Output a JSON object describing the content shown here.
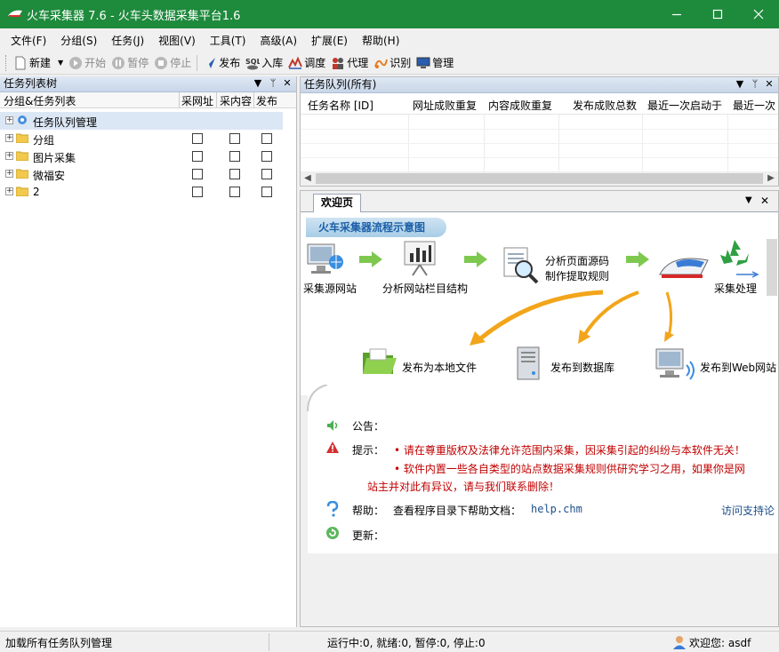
{
  "window": {
    "title": "火车采集器 7.6 - 火车头数据采集平台1.6"
  },
  "menu": [
    "文件(F)",
    "分组(S)",
    "任务(J)",
    "视图(V)",
    "工具(T)",
    "高级(A)",
    "扩展(E)",
    "帮助(H)"
  ],
  "toolbar": {
    "new": "新建",
    "start": "开始",
    "pause": "暂停",
    "stop": "停止",
    "publish": "发布",
    "import": "入库",
    "schedule": "调度",
    "proxy": "代理",
    "recognize": "识别",
    "manage": "管理"
  },
  "tree_panel": {
    "title": "任务列表树",
    "col_name": "分组&任务列表",
    "col_url": "采网址",
    "col_content": "采内容",
    "col_publish": "发布",
    "items": [
      "任务队列管理",
      "分组",
      "图片采集",
      "微福安",
      "2"
    ]
  },
  "queue_panel": {
    "title": "任务队列(所有)",
    "columns": [
      "任务名称 [ID]",
      "网址成败重复",
      "内容成败重复",
      "发布成败总数",
      "最近一次启动于",
      "最近一次"
    ]
  },
  "welcome": {
    "tab": "欢迎页",
    "banner": "火车采集器流程示意图",
    "flow": {
      "source": "采集源网站",
      "analyze_site": "分析网站栏目结构",
      "analyze_source_1": "分析页面源码",
      "analyze_source_2": "制作提取规则",
      "process": "采集处理",
      "pub_local": "发布为本地文件",
      "pub_db": "发布到数据库",
      "pub_web": "发布到Web网站"
    },
    "notice_label": "公告：",
    "tip_label": "提示：",
    "tip_1": "• 请在尊重版权及法律允许范围内采集，因采集引起的纠纷与本软件无关！",
    "tip_2a": "• 软件内置一些各自类型的站点数据采集规则供研究学习之用，如果你是网",
    "tip_2b": "站主并对此有异议，请与我们联系删除！",
    "help_label": "帮助：",
    "help_text": "查看程序目录下帮助文档：",
    "help_file": "help.chm",
    "support_link": "访问支持论",
    "update_label": "更新："
  },
  "status": {
    "left": "加载所有任务队列管理",
    "counts": "运行中:0, 就绪:0, 暂停:0, 停止:0",
    "welcome_user": "欢迎您: asdf"
  },
  "colors": {
    "titlebar": "#1e8a3c",
    "tip_red": "#c00000",
    "link_blue": "#1b4f8a"
  }
}
